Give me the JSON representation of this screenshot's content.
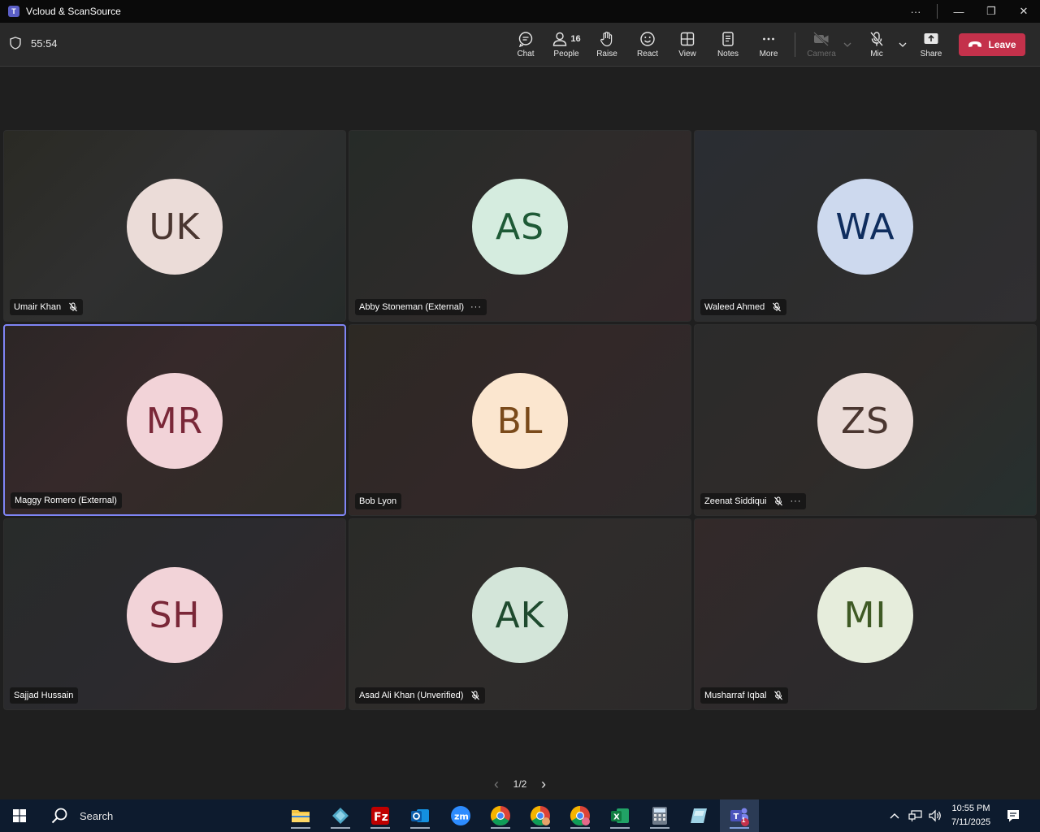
{
  "window": {
    "title": "Vcloud & ScanSource",
    "more_glyph": "···",
    "minimize_glyph": "—",
    "restore_glyph": "❐",
    "close_glyph": "✕"
  },
  "meeting": {
    "timer": "55:54",
    "toolbar": {
      "chat": "Chat",
      "people": "People",
      "people_count": "16",
      "raise": "Raise",
      "react": "React",
      "view": "View",
      "notes": "Notes",
      "more": "More",
      "camera": "Camera",
      "mic": "Mic",
      "share": "Share",
      "leave": "Leave"
    },
    "participants": [
      {
        "initials": "UK",
        "name": "Umair Khan",
        "muted": true,
        "more": false,
        "avatar_bg": "#ebdcd8",
        "avatar_fg": "#4a3630"
      },
      {
        "initials": "AS",
        "name": "Abby Stoneman (External)",
        "muted": false,
        "more": true,
        "avatar_bg": "#d5ecdf",
        "avatar_fg": "#1e5a36"
      },
      {
        "initials": "WA",
        "name": "Waleed Ahmed",
        "muted": true,
        "more": false,
        "avatar_bg": "#cdd9ee",
        "avatar_fg": "#0f2d5e"
      },
      {
        "initials": "MR",
        "name": "Maggy Romero (External)",
        "muted": false,
        "more": false,
        "avatar_bg": "#f2d3d8",
        "avatar_fg": "#7a2738"
      },
      {
        "initials": "BL",
        "name": "Bob Lyon",
        "muted": false,
        "more": false,
        "avatar_bg": "#fbe6cf",
        "avatar_fg": "#7a4a1a"
      },
      {
        "initials": "ZS",
        "name": "Zeenat Siddiqui",
        "muted": true,
        "more": true,
        "avatar_bg": "#ebdcd8",
        "avatar_fg": "#4a3630"
      },
      {
        "initials": "SH",
        "name": "Sajjad Hussain",
        "muted": false,
        "more": false,
        "avatar_bg": "#f2d3d8",
        "avatar_fg": "#7a2738"
      },
      {
        "initials": "AK",
        "name": "Asad Ali Khan (Unverified)",
        "muted": true,
        "more": false,
        "avatar_bg": "#d3e5d9",
        "avatar_fg": "#1e4a2e"
      },
      {
        "initials": "MI",
        "name": "Musharraf Iqbal",
        "muted": true,
        "more": false,
        "avatar_bg": "#e6eddc",
        "avatar_fg": "#3f5a25"
      }
    ],
    "pager": {
      "label": "1/2",
      "prev": "‹",
      "next": "›"
    }
  },
  "taskbar": {
    "search_label": "Search",
    "apps": [
      "file-explorer",
      "app-diamond",
      "filezilla",
      "outlook",
      "zoom",
      "chrome",
      "chrome-profile-2",
      "chrome-profile-3",
      "excel",
      "calculator",
      "notes-app",
      "teams"
    ],
    "teams_badge": "1",
    "time": "10:55 PM",
    "date": "7/11/2025"
  },
  "colors": {
    "accent": "#7f85f5",
    "leave": "#c4314b",
    "stage_bg": "#1f1f1f"
  }
}
